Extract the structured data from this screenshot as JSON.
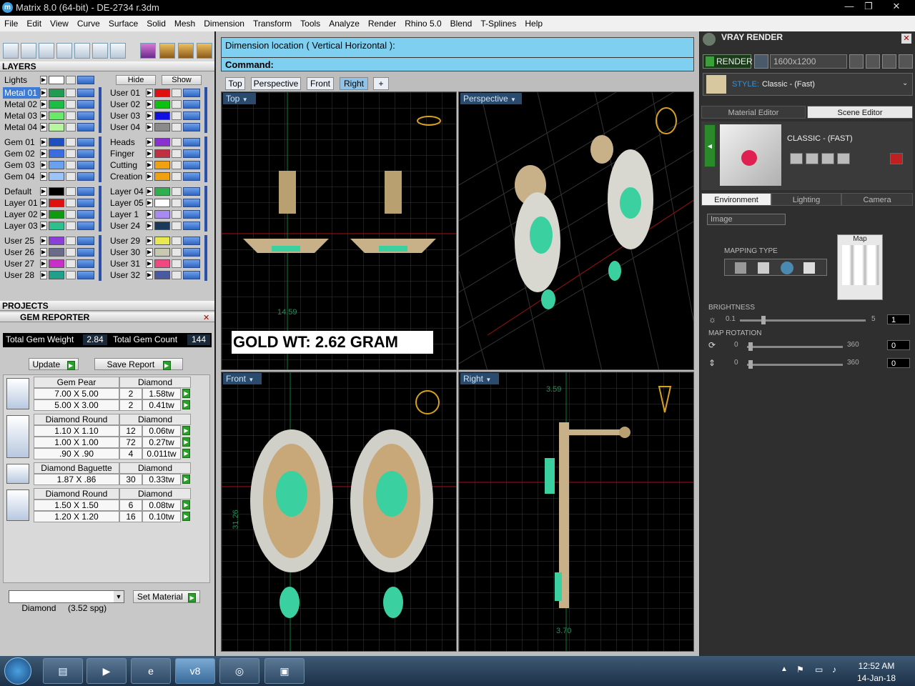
{
  "window": {
    "title": "Matrix 8.0 (64-bit) - DE-2734 r.3dm",
    "app_icon": "m"
  },
  "menu": [
    "File",
    "Edit",
    "View",
    "Curve",
    "Surface",
    "Solid",
    "Mesh",
    "Dimension",
    "Transform",
    "Tools",
    "Analyze",
    "Render",
    "Rhino 5.0",
    "Blend",
    "T-Splines",
    "Help"
  ],
  "layers": {
    "title": "LAYERS",
    "lights_label": "Lights",
    "hide_label": "Hide",
    "show_label": "Show",
    "left_col": [
      {
        "name": "Metal 01",
        "color": "#1f9c4f",
        "sel": true
      },
      {
        "name": "Metal 02",
        "color": "#1bbd44"
      },
      {
        "name": "Metal 03",
        "color": "#6be86b"
      },
      {
        "name": "Metal 04",
        "color": "#b8f5a0"
      },
      {
        "name": "Gem 01",
        "color": "#1e4fc0"
      },
      {
        "name": "Gem 02",
        "color": "#3a6ee0"
      },
      {
        "name": "Gem 03",
        "color": "#6aa0f0"
      },
      {
        "name": "Gem 04",
        "color": "#9cc4f8"
      },
      {
        "name": "Default",
        "color": "#000000"
      },
      {
        "name": "Layer 01",
        "color": "#e01010"
      },
      {
        "name": "Layer 02",
        "color": "#0f9a0f"
      },
      {
        "name": "Layer 03",
        "color": "#2fbf8f"
      },
      {
        "name": "User 25",
        "color": "#8a3fd8"
      },
      {
        "name": "User 26",
        "color": "#6a6a8a"
      },
      {
        "name": "User 27",
        "color": "#c82fc8"
      },
      {
        "name": "User 28",
        "color": "#1fa08a"
      }
    ],
    "right_col": [
      {
        "name": "User 01",
        "color": "#e01010"
      },
      {
        "name": "User 02",
        "color": "#10c010"
      },
      {
        "name": "User 03",
        "color": "#1010e0"
      },
      {
        "name": "User 04",
        "color": "#8a8a8a"
      },
      {
        "name": "Heads",
        "color": "#8a2fd0"
      },
      {
        "name": "Finger",
        "color": "#c03040"
      },
      {
        "name": "Cutting",
        "color": "#f0a010"
      },
      {
        "name": "Creation",
        "color": "#f0a010"
      },
      {
        "name": "Layer 04",
        "color": "#2fb050"
      },
      {
        "name": "Layer 05",
        "color": "#ffffff"
      },
      {
        "name": "Layer 1",
        "color": "#a88af0"
      },
      {
        "name": "User 24",
        "color": "#1a3a5a"
      },
      {
        "name": "User 29",
        "color": "#e8e850"
      },
      {
        "name": "User 30",
        "color": "#c8c8b0"
      },
      {
        "name": "User 31",
        "color": "#f04880"
      },
      {
        "name": "User 32",
        "color": "#4a5aa0"
      }
    ]
  },
  "projects": {
    "title": "PROJECTS"
  },
  "gem_reporter": {
    "title": "GEM REPORTER",
    "weight_label": "Total Gem Weight",
    "weight_value": "2.84",
    "count_label": "Total Gem Count",
    "count_value": "144",
    "update_label": "Update",
    "save_label": "Save Report",
    "groups": [
      {
        "shape": "Gem Pear",
        "material": "Diamond",
        "rows": [
          [
            "7.00 X 5.00",
            "2",
            "1.58tw"
          ],
          [
            "5.00 X 3.00",
            "2",
            "0.41tw"
          ]
        ]
      },
      {
        "shape": "Diamond Round",
        "material": "Diamond",
        "rows": [
          [
            "1.10 X 1.10",
            "12",
            "0.06tw"
          ],
          [
            "1.00 X 1.00",
            "72",
            "0.27tw"
          ],
          [
            ".90 X .90",
            "4",
            "0.011tw"
          ]
        ]
      },
      {
        "shape": "Diamond Baguette",
        "material": "Diamond",
        "rows": [
          [
            "1.87 X .86",
            "30",
            "0.33tw"
          ]
        ]
      },
      {
        "shape": "Diamond Round",
        "material": "Diamond",
        "rows": [
          [
            "1.50 X 1.50",
            "6",
            "0.08tw"
          ],
          [
            "1.20 X 1.20",
            "16",
            "0.10tw"
          ]
        ]
      }
    ],
    "material_select": "Diamond     (3.52 spg)",
    "set_material_label": "Set Material"
  },
  "command": {
    "prompt": "Dimension location ( Vertical  Horizontal ):",
    "command_label": "Command:"
  },
  "view_tabs": [
    "Top",
    "Perspective",
    "Front",
    "Right"
  ],
  "view_tabs_selected": "Right",
  "viewports": {
    "top": {
      "label": "Top",
      "dim": "14.59",
      "annotation": "GOLD WT: 2.62 GRAM"
    },
    "perspective": {
      "label": "Perspective"
    },
    "front": {
      "label": "Front",
      "dim": "31.26"
    },
    "right": {
      "label": "Right",
      "dim_top": "3.59",
      "dim_bottom": "3.70"
    }
  },
  "vray": {
    "title": "VRAY RENDER",
    "render_label": "RENDER",
    "resolution": "1600x1200",
    "style_label": "STYLE:",
    "style_value": "Classic - (Fast)",
    "tabs": [
      "Material Editor",
      "Scene Editor"
    ],
    "preset_name": "CLASSIC - (FAST)",
    "env_tabs": [
      "Environment",
      "Lighting",
      "Camera"
    ],
    "env_select": "Image",
    "map_label": "Map",
    "mapping_type_label": "MAPPING TYPE",
    "brightness_label": "BRIGHTNESS",
    "brightness_min": "0.1",
    "brightness_max": "5",
    "brightness_value": "1",
    "map_rotation_label": "MAP ROTATION",
    "rot1_min": "0",
    "rot1_max": "360",
    "rot1_value": "0",
    "rot2_min": "0",
    "rot2_max": "360",
    "rot2_value": "0"
  },
  "tray": {
    "time": "12:52 AM",
    "date": "14-Jan-18"
  },
  "taskbar_apps": [
    "folder-icon",
    "media-icon",
    "ie-icon",
    "v8-icon",
    "ring-icon",
    "window-icon"
  ]
}
